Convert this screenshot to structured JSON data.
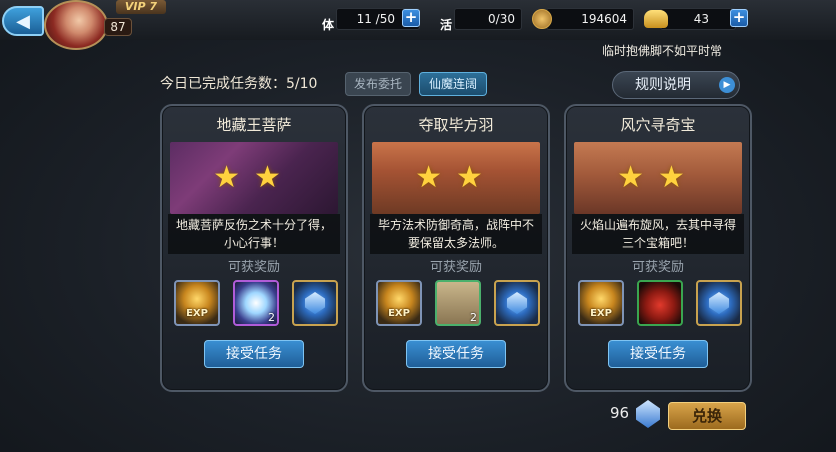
{
  "player": {
    "vip": "VIP 7",
    "level": "87"
  },
  "resources": {
    "stamina": {
      "label": "体",
      "value": "11 /50"
    },
    "energy": {
      "label": "活",
      "value": "0/30"
    },
    "coins": {
      "value": "194604"
    },
    "ingots": {
      "value": "43"
    }
  },
  "marquee": "临时抱佛脚不如平时常",
  "header": {
    "progress_text": "今日已完成任务数：5/10",
    "tab_publish": "发布委托",
    "tab_event": "仙魔连阔",
    "rules_label": "规则说明"
  },
  "cards": [
    {
      "title": "地藏王菩萨",
      "stars": "★★",
      "desc": "地藏菩萨反伤之术十分了得，小心行事！",
      "reward_label": "可获奖励",
      "rewards": [
        {
          "type": "exp",
          "label": "EXP",
          "count": ""
        },
        {
          "type": "orb",
          "label": "",
          "count": "2"
        },
        {
          "type": "gem",
          "label": "",
          "count": ""
        }
      ],
      "button": "接受任务"
    },
    {
      "title": "夺取毕方羽",
      "stars": "★★",
      "desc": "毕方法术防御奇高，战阵中不要保留太多法师。",
      "reward_label": "可获奖励",
      "rewards": [
        {
          "type": "exp",
          "label": "EXP",
          "count": ""
        },
        {
          "type": "scroll",
          "label": "",
          "count": "2"
        },
        {
          "type": "gem",
          "label": "",
          "count": ""
        }
      ],
      "button": "接受任务"
    },
    {
      "title": "风穴寻奇宝",
      "stars": "★★",
      "desc": "火焰山遍布旋风，去其中寻得三个宝箱吧！",
      "reward_label": "可获奖励",
      "rewards": [
        {
          "type": "exp",
          "label": "EXP",
          "count": ""
        },
        {
          "type": "bag",
          "label": "",
          "count": ""
        },
        {
          "type": "gem",
          "label": "",
          "count": ""
        }
      ],
      "button": "接受任务"
    }
  ],
  "footer": {
    "points": "96",
    "exchange_label": "兑换"
  }
}
